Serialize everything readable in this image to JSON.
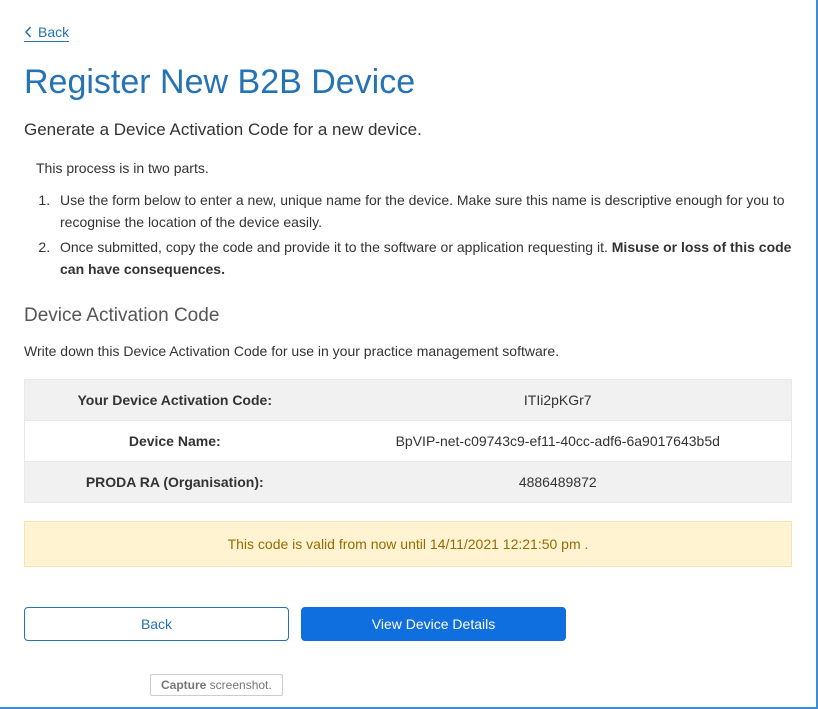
{
  "nav": {
    "back_label": "Back"
  },
  "heading": "Register New B2B Device",
  "subtitle": "Generate a Device Activation Code for a new device.",
  "steps_intro": "This process is in two parts.",
  "step1": "Use the form below to enter a new, unique name for the device. Make sure this name is descriptive enough for you to recognise the location of the device easily.",
  "step2_a": "Once submitted, copy the code and provide it to the software or application requesting it. ",
  "step2_b": "Misuse or loss of this code can have consequences.",
  "section_heading": "Device Activation Code",
  "writedown": "Write down this Device Activation Code for use in your practice management software.",
  "rows": {
    "code_label": "Your Device Activation Code:",
    "code_value": "ITIi2pKGr7",
    "name_label": "Device Name:",
    "name_value": "BpVIP-net-c09743c9-ef11-40cc-adf6-6a9017643b5d",
    "ra_label": "PRODA RA (Organisation):",
    "ra_value": "4886489872"
  },
  "notice": "This code is valid from now until 14/11/2021 12:21:50 pm .",
  "buttons": {
    "back": "Back",
    "view_details": "View Device Details"
  },
  "capture": {
    "bold": "Capture",
    "rest": " screenshot."
  }
}
